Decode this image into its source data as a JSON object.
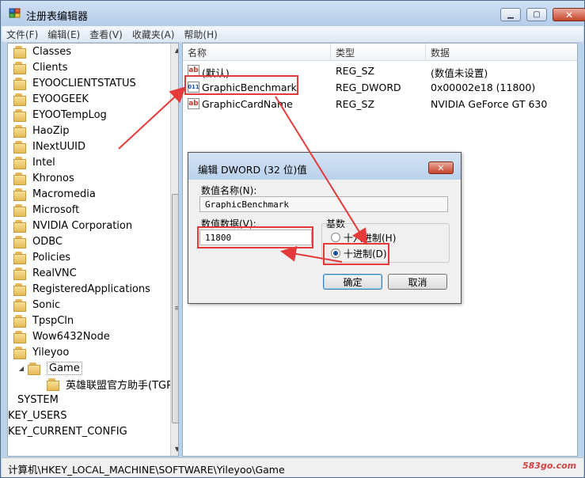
{
  "window": {
    "title": "注册表编辑器",
    "controls": {
      "minimize": "▁",
      "maximize": "▢",
      "close": "✕"
    }
  },
  "menu": [
    "文件(F)",
    "编辑(E)",
    "查看(V)",
    "收藏夹(A)",
    "帮助(H)"
  ],
  "tree": {
    "items": [
      "Classes",
      "Clients",
      "EYOOCLIENTSTATUS",
      "EYOOGEEK",
      "EYOOTempLog",
      "HaoZip",
      "INextUUID",
      "Intel",
      "Khronos",
      "Macromedia",
      "Microsoft",
      "NVIDIA Corporation",
      "ODBC",
      "Policies",
      "RealVNC",
      "RegisteredApplications",
      "Sonic",
      "TpspCln",
      "Wow6432Node",
      "Yileyoo"
    ],
    "selected": "Game",
    "child": "英雄联盟官方助手(TGP)",
    "root_items": [
      "SYSTEM",
      "KEY_USERS",
      "KEY_CURRENT_CONFIG"
    ]
  },
  "list": {
    "columns": [
      "名称",
      "类型",
      "数据"
    ],
    "rows": [
      {
        "icon": "ab",
        "name": "(默认)",
        "type": "REG_SZ",
        "data": "(数值未设置)"
      },
      {
        "icon": "011",
        "name": "GraphicBenchmark",
        "type": "REG_DWORD",
        "data": "0x00002e18 (11800)"
      },
      {
        "icon": "ab",
        "name": "GraphicCardName",
        "type": "REG_SZ",
        "data": "NVIDIA GeForce GT 630"
      }
    ]
  },
  "dialog": {
    "title": "编辑 DWORD (32 位)值",
    "close": "✕",
    "name_label": "数值名称(N):",
    "name_value": "GraphicBenchmark",
    "data_label": "数值数据(V):",
    "data_value": "11800",
    "base_label": "基数",
    "hex_label": "十六进制(H)",
    "dec_label": "十进制(D)",
    "ok": "确定",
    "cancel": "取消"
  },
  "status": "计算机\\HKEY_LOCAL_MACHINE\\SOFTWARE\\Yileyoo\\Game",
  "watermark": "583go.com",
  "colors": {
    "annotation": "#e53a3a",
    "title_bar": "#bcd3ec",
    "selected_radio": "#1d4e9a"
  }
}
